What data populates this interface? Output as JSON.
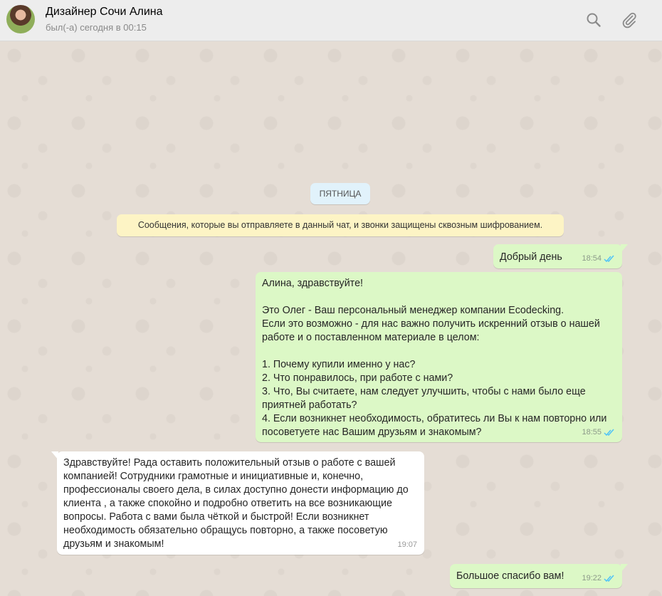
{
  "header": {
    "contact_name": "Дизайнер Сочи Алина",
    "status": "был(-а) сегодня в 00:15",
    "icons": [
      "search-icon",
      "paperclip-icon"
    ]
  },
  "chat": {
    "date_chip": "ПЯТНИЦА",
    "encryption_notice": "Сообщения, которые вы отправляете в данный чат, и звонки защищены сквозным шифрованием.",
    "messages": [
      {
        "direction": "out",
        "text": "Добрый день",
        "time": "18:54",
        "status": "read"
      },
      {
        "direction": "out",
        "text": "Алина, здравствуйте!\n\nЭто Олег - Ваш персональный менеджер компании Ecodecking.\nЕсли это возможно - для нас важно получить искренний отзыв о нашей работе и о поставленном материале в целом:\n\n1. Почему купили именно у нас?\n2. Что понравилось, при работе с нами?\n3. Что, Вы считаете, нам следует улучшить, чтобы с нами было еще приятней работать?\n4. Если возникнет необходимость, обратитесь ли Вы к нам повторно или посоветуете нас Вашим друзьям и знакомым?",
        "time": "18:55",
        "status": "read"
      },
      {
        "direction": "in",
        "text": "Здравствуйте! Рада оставить положительный отзыв о работе с вашей компанией! Сотрудники грамотные и инициативные и, конечно, профессионалы своего дела, в силах доступно донести информацию до клиента , а также спокойно и подробно ответить на все возникающие вопросы. Работа с вами была чёткой и быстрой! Если возникнет необходимость обязательно обращусь повторно, а также посоветую друзьям и знакомым!",
        "time": "19:07"
      },
      {
        "direction": "out",
        "text": "Большое спасибо вам!",
        "time": "19:22",
        "status": "read"
      }
    ]
  },
  "colors": {
    "header_bg": "#ededed",
    "chat_bg": "#e5ddd5",
    "outgoing_bubble": "#dcf8c6",
    "incoming_bubble": "#ffffff",
    "read_ticks": "#4fc3f7",
    "notice_bg": "#fdf4c5",
    "date_chip_bg": "#e1f2fb"
  }
}
